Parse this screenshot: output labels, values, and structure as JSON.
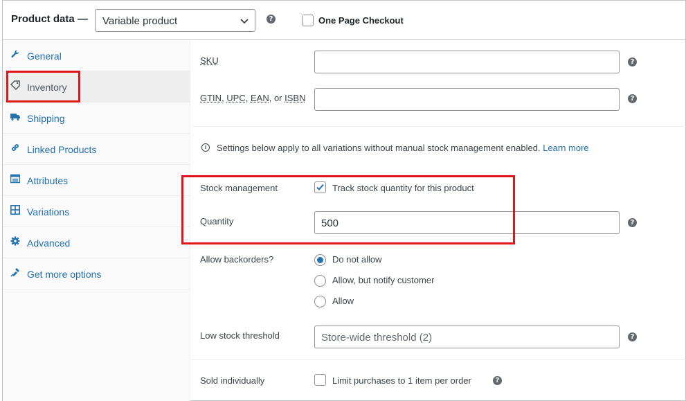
{
  "header": {
    "title": "Product data —",
    "product_type": "Variable product",
    "one_page_checkout_label": "One Page Checkout"
  },
  "sidebar": {
    "items": [
      {
        "label": "General",
        "icon": "wrench-icon"
      },
      {
        "label": "Inventory",
        "icon": "tag-icon",
        "active": true
      },
      {
        "label": "Shipping",
        "icon": "truck-icon"
      },
      {
        "label": "Linked Products",
        "icon": "link-icon"
      },
      {
        "label": "Attributes",
        "icon": "list-icon"
      },
      {
        "label": "Variations",
        "icon": "grid-icon"
      },
      {
        "label": "Advanced",
        "icon": "gear-icon"
      },
      {
        "label": "Get more options",
        "icon": "plugin-icon"
      }
    ]
  },
  "inventory": {
    "sku_label": "SKU",
    "sku_value": "",
    "gtin_label_parts": [
      "GTIN",
      "UPC",
      "EAN",
      "ISBN"
    ],
    "gtin_sep": ", ",
    "gtin_or": "or ",
    "gtin_value": "",
    "info_text": "Settings below apply to all variations without manual stock management enabled.",
    "learn_more": "Learn more",
    "stock_management_label": "Stock management",
    "track_stock_label": "Track stock quantity for this product",
    "track_stock_checked": true,
    "quantity_label": "Quantity",
    "quantity_value": "500",
    "backorders_label": "Allow backorders?",
    "backorder_options": [
      {
        "label": "Do not allow",
        "selected": true
      },
      {
        "label": "Allow, but notify customer",
        "selected": false
      },
      {
        "label": "Allow",
        "selected": false
      }
    ],
    "low_stock_label": "Low stock threshold",
    "low_stock_placeholder": "Store-wide threshold (2)",
    "sold_individually_label": "Sold individually",
    "limit_purchases_label": "Limit purchases to 1 item per order"
  },
  "colors": {
    "link": "#2271b1",
    "highlight": "#e0141b"
  }
}
